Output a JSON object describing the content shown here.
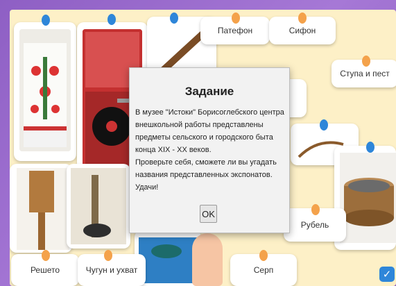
{
  "board": {
    "labels": {
      "patefon": "Патефон",
      "sifon": "Сифон",
      "stupa": "Ступа и пест",
      "rubel": "Рубель",
      "reshto": "Решето",
      "chugun": "Чугун и ухват",
      "serp": "Серп"
    }
  },
  "modal": {
    "title": "Задание",
    "paragraph1": "В музее \"Истоки\" Борисоглебского центра внешкольной работы представлены предметы сельского и городского быта конца XIX - XX веков.",
    "paragraph2": "Проверьте себя, сможете ли вы угадать названия представленных экспонатов. Удачи!",
    "ok_label": "OK"
  },
  "colors": {
    "frame": "#9b6fc7",
    "board": "#fdf0c7",
    "pin_blue": "#2e86d9",
    "pin_orange": "#f4a24b"
  }
}
